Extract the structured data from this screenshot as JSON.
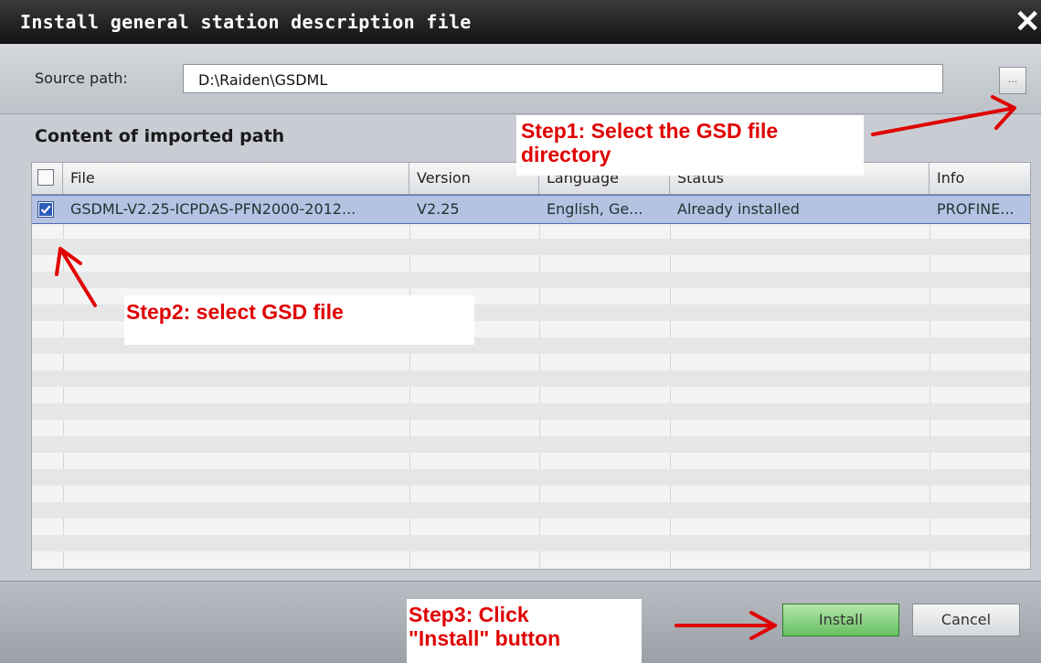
{
  "dialog": {
    "title": "Install general station description file",
    "close_symbol": "✕"
  },
  "source": {
    "label": "Source path:",
    "value": "D:\\Raiden\\GSDML",
    "browse_label": "..."
  },
  "content": {
    "title": "Content of imported path",
    "columns": [
      "File",
      "Version",
      "Language",
      "Status",
      "Info"
    ],
    "rows": [
      {
        "checked": true,
        "file": "GSDML-V2.25-ICPDAS-PFN2000-2012...",
        "version": "V2.25",
        "language": "English, Ge...",
        "status": "Already installed",
        "info": "PROFINE..."
      }
    ]
  },
  "buttons": {
    "install": "Install",
    "cancel": "Cancel"
  },
  "annotations": {
    "step1": "Step1: Select the GSD file\ndirectory",
    "step2": "Step2: select GSD file",
    "step3": "Step3: Click\n\"Install\" button"
  },
  "colors": {
    "annotation": "#e00000",
    "title_bar": "#1b1b1b",
    "selection": "#b4c3e2",
    "install_button": "#7dcc74"
  }
}
